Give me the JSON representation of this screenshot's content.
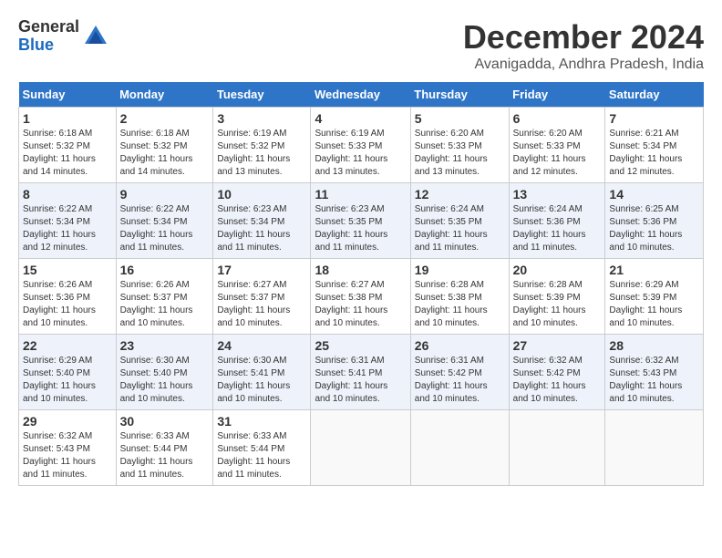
{
  "logo": {
    "general": "General",
    "blue": "Blue"
  },
  "title": "December 2024",
  "location": "Avanigadda, Andhra Pradesh, India",
  "headers": [
    "Sunday",
    "Monday",
    "Tuesday",
    "Wednesday",
    "Thursday",
    "Friday",
    "Saturday"
  ],
  "weeks": [
    [
      {
        "day": "1",
        "info": "Sunrise: 6:18 AM\nSunset: 5:32 PM\nDaylight: 11 hours\nand 14 minutes."
      },
      {
        "day": "2",
        "info": "Sunrise: 6:18 AM\nSunset: 5:32 PM\nDaylight: 11 hours\nand 14 minutes."
      },
      {
        "day": "3",
        "info": "Sunrise: 6:19 AM\nSunset: 5:32 PM\nDaylight: 11 hours\nand 13 minutes."
      },
      {
        "day": "4",
        "info": "Sunrise: 6:19 AM\nSunset: 5:33 PM\nDaylight: 11 hours\nand 13 minutes."
      },
      {
        "day": "5",
        "info": "Sunrise: 6:20 AM\nSunset: 5:33 PM\nDaylight: 11 hours\nand 13 minutes."
      },
      {
        "day": "6",
        "info": "Sunrise: 6:20 AM\nSunset: 5:33 PM\nDaylight: 11 hours\nand 12 minutes."
      },
      {
        "day": "7",
        "info": "Sunrise: 6:21 AM\nSunset: 5:34 PM\nDaylight: 11 hours\nand 12 minutes."
      }
    ],
    [
      {
        "day": "8",
        "info": "Sunrise: 6:22 AM\nSunset: 5:34 PM\nDaylight: 11 hours\nand 12 minutes."
      },
      {
        "day": "9",
        "info": "Sunrise: 6:22 AM\nSunset: 5:34 PM\nDaylight: 11 hours\nand 11 minutes."
      },
      {
        "day": "10",
        "info": "Sunrise: 6:23 AM\nSunset: 5:34 PM\nDaylight: 11 hours\nand 11 minutes."
      },
      {
        "day": "11",
        "info": "Sunrise: 6:23 AM\nSunset: 5:35 PM\nDaylight: 11 hours\nand 11 minutes."
      },
      {
        "day": "12",
        "info": "Sunrise: 6:24 AM\nSunset: 5:35 PM\nDaylight: 11 hours\nand 11 minutes."
      },
      {
        "day": "13",
        "info": "Sunrise: 6:24 AM\nSunset: 5:36 PM\nDaylight: 11 hours\nand 11 minutes."
      },
      {
        "day": "14",
        "info": "Sunrise: 6:25 AM\nSunset: 5:36 PM\nDaylight: 11 hours\nand 10 minutes."
      }
    ],
    [
      {
        "day": "15",
        "info": "Sunrise: 6:26 AM\nSunset: 5:36 PM\nDaylight: 11 hours\nand 10 minutes."
      },
      {
        "day": "16",
        "info": "Sunrise: 6:26 AM\nSunset: 5:37 PM\nDaylight: 11 hours\nand 10 minutes."
      },
      {
        "day": "17",
        "info": "Sunrise: 6:27 AM\nSunset: 5:37 PM\nDaylight: 11 hours\nand 10 minutes."
      },
      {
        "day": "18",
        "info": "Sunrise: 6:27 AM\nSunset: 5:38 PM\nDaylight: 11 hours\nand 10 minutes."
      },
      {
        "day": "19",
        "info": "Sunrise: 6:28 AM\nSunset: 5:38 PM\nDaylight: 11 hours\nand 10 minutes."
      },
      {
        "day": "20",
        "info": "Sunrise: 6:28 AM\nSunset: 5:39 PM\nDaylight: 11 hours\nand 10 minutes."
      },
      {
        "day": "21",
        "info": "Sunrise: 6:29 AM\nSunset: 5:39 PM\nDaylight: 11 hours\nand 10 minutes."
      }
    ],
    [
      {
        "day": "22",
        "info": "Sunrise: 6:29 AM\nSunset: 5:40 PM\nDaylight: 11 hours\nand 10 minutes."
      },
      {
        "day": "23",
        "info": "Sunrise: 6:30 AM\nSunset: 5:40 PM\nDaylight: 11 hours\nand 10 minutes."
      },
      {
        "day": "24",
        "info": "Sunrise: 6:30 AM\nSunset: 5:41 PM\nDaylight: 11 hours\nand 10 minutes."
      },
      {
        "day": "25",
        "info": "Sunrise: 6:31 AM\nSunset: 5:41 PM\nDaylight: 11 hours\nand 10 minutes."
      },
      {
        "day": "26",
        "info": "Sunrise: 6:31 AM\nSunset: 5:42 PM\nDaylight: 11 hours\nand 10 minutes."
      },
      {
        "day": "27",
        "info": "Sunrise: 6:32 AM\nSunset: 5:42 PM\nDaylight: 11 hours\nand 10 minutes."
      },
      {
        "day": "28",
        "info": "Sunrise: 6:32 AM\nSunset: 5:43 PM\nDaylight: 11 hours\nand 10 minutes."
      }
    ],
    [
      {
        "day": "29",
        "info": "Sunrise: 6:32 AM\nSunset: 5:43 PM\nDaylight: 11 hours\nand 11 minutes."
      },
      {
        "day": "30",
        "info": "Sunrise: 6:33 AM\nSunset: 5:44 PM\nDaylight: 11 hours\nand 11 minutes."
      },
      {
        "day": "31",
        "info": "Sunrise: 6:33 AM\nSunset: 5:44 PM\nDaylight: 11 hours\nand 11 minutes."
      },
      {
        "day": "",
        "info": ""
      },
      {
        "day": "",
        "info": ""
      },
      {
        "day": "",
        "info": ""
      },
      {
        "day": "",
        "info": ""
      }
    ]
  ]
}
